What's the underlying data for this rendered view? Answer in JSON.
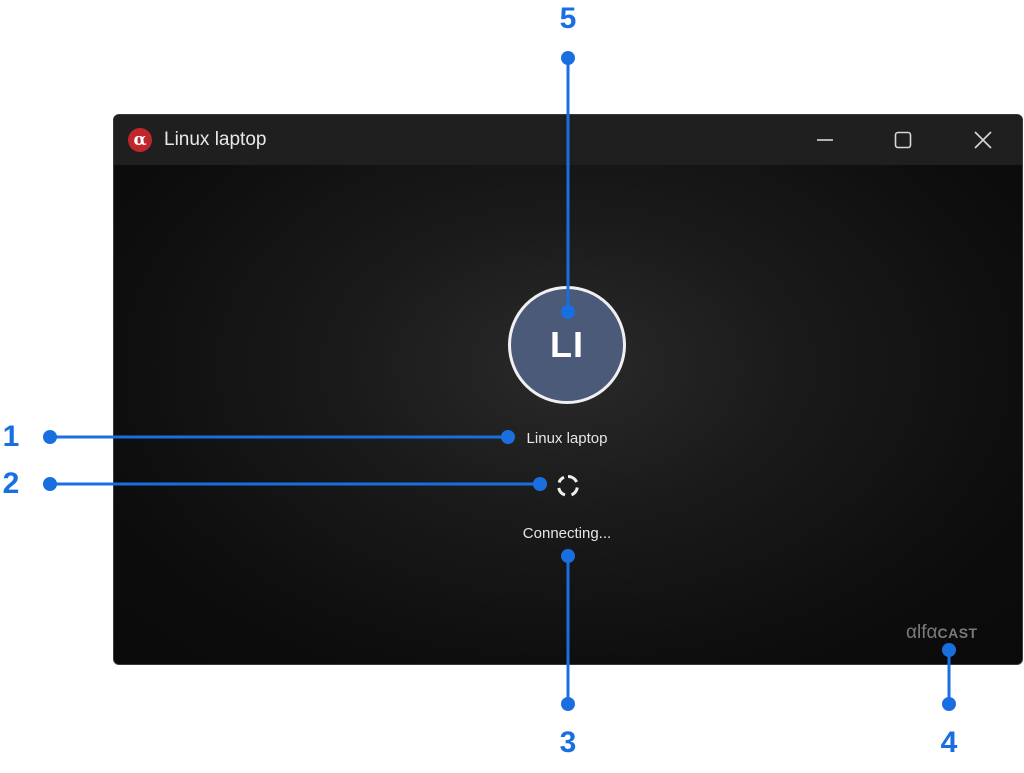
{
  "window": {
    "title": "Linux laptop",
    "app_logo_glyph": "α",
    "controls": {
      "minimize": "minimize-icon",
      "maximize": "maximize-icon",
      "close": "close-icon"
    }
  },
  "content": {
    "avatar_initials": "LI",
    "device_name": "Linux laptop",
    "status": "Connecting...",
    "brand_logo_part1": "αlfα",
    "brand_logo_part2": "CAST"
  },
  "callouts": [
    {
      "number": "1"
    },
    {
      "number": "2"
    },
    {
      "number": "3"
    },
    {
      "number": "4"
    },
    {
      "number": "5"
    }
  ],
  "colors": {
    "callout": "#1a6fe0",
    "app_logo": "#c0272d",
    "avatar_bg": "#4a5a78",
    "titlebar": "#1f1f1f",
    "window_bg": "#111111"
  }
}
